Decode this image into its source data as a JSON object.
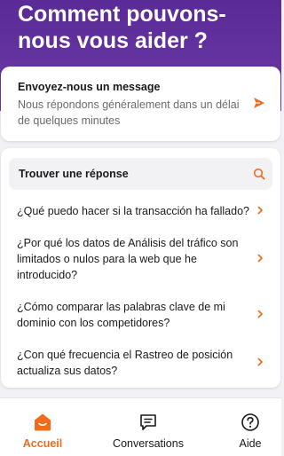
{
  "header": {
    "title": "Comment pouvons-nous vous aider ?"
  },
  "message_card": {
    "title": "Envoyez-nous un message",
    "subtitle": "Nous répondons généralement dans un délai de quelques minutes",
    "icon": "send-icon"
  },
  "faq": {
    "search_label": "Trouver une réponse",
    "search_icon": "search-icon",
    "items": [
      {
        "label": "¿Qué puedo hacer si la transacción ha fallado?"
      },
      {
        "label": "¿Por qué los datos de Análisis del tráfico son limitados o nulos para la web que he introducido?"
      },
      {
        "label": "¿Cómo comparar las palabras clave de mi dominio con los competidores?"
      },
      {
        "label": "¿Con qué frecuencia el Rastreo de posición actualiza sus datos?"
      }
    ]
  },
  "bottom_nav": {
    "items": [
      {
        "label": "Accueil",
        "icon": "home-icon",
        "active": true
      },
      {
        "label": "Conversations",
        "icon": "conversations-icon",
        "active": false
      },
      {
        "label": "Aide",
        "icon": "help-icon",
        "active": false
      }
    ]
  },
  "colors": {
    "header_bg": "#5a2a96",
    "accent": "#f26b1d",
    "card_bg": "#ffffff",
    "page_bg": "#f2f1f5"
  }
}
